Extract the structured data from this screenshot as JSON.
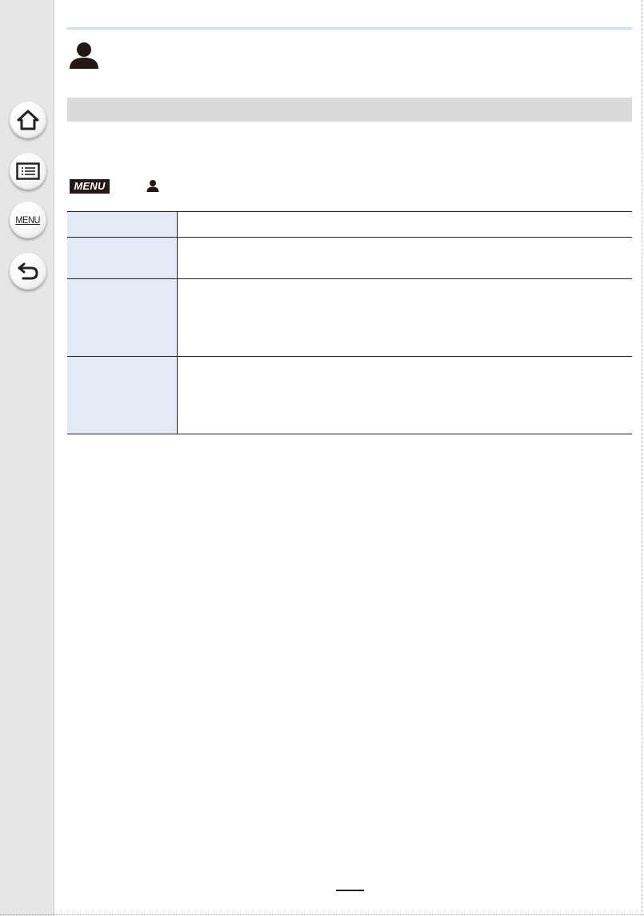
{
  "sidebar": {
    "buttons": [
      {
        "name": "home",
        "icon": "home-icon"
      },
      {
        "name": "contents",
        "icon": "list-icon"
      },
      {
        "name": "menu",
        "icon": "menu-icon",
        "label": "MENU"
      },
      {
        "name": "back",
        "icon": "back-arrow-icon"
      }
    ]
  },
  "header": {
    "icon": "person-icon"
  },
  "menu_path": {
    "badge": "MENU",
    "icon": "person-icon"
  },
  "colors": {
    "sidebar_bg": "#e6e6e6",
    "top_rule": "#cfe0ef",
    "section_bar": "#dadada",
    "table_label_cell": "#e3eaf6",
    "menu_badge_bg": "#231815"
  },
  "table": {
    "rows": [
      {
        "name": "",
        "description": ""
      },
      {
        "name": "",
        "description": ""
      },
      {
        "name": "",
        "description": ""
      },
      {
        "name": "",
        "description": ""
      }
    ]
  }
}
